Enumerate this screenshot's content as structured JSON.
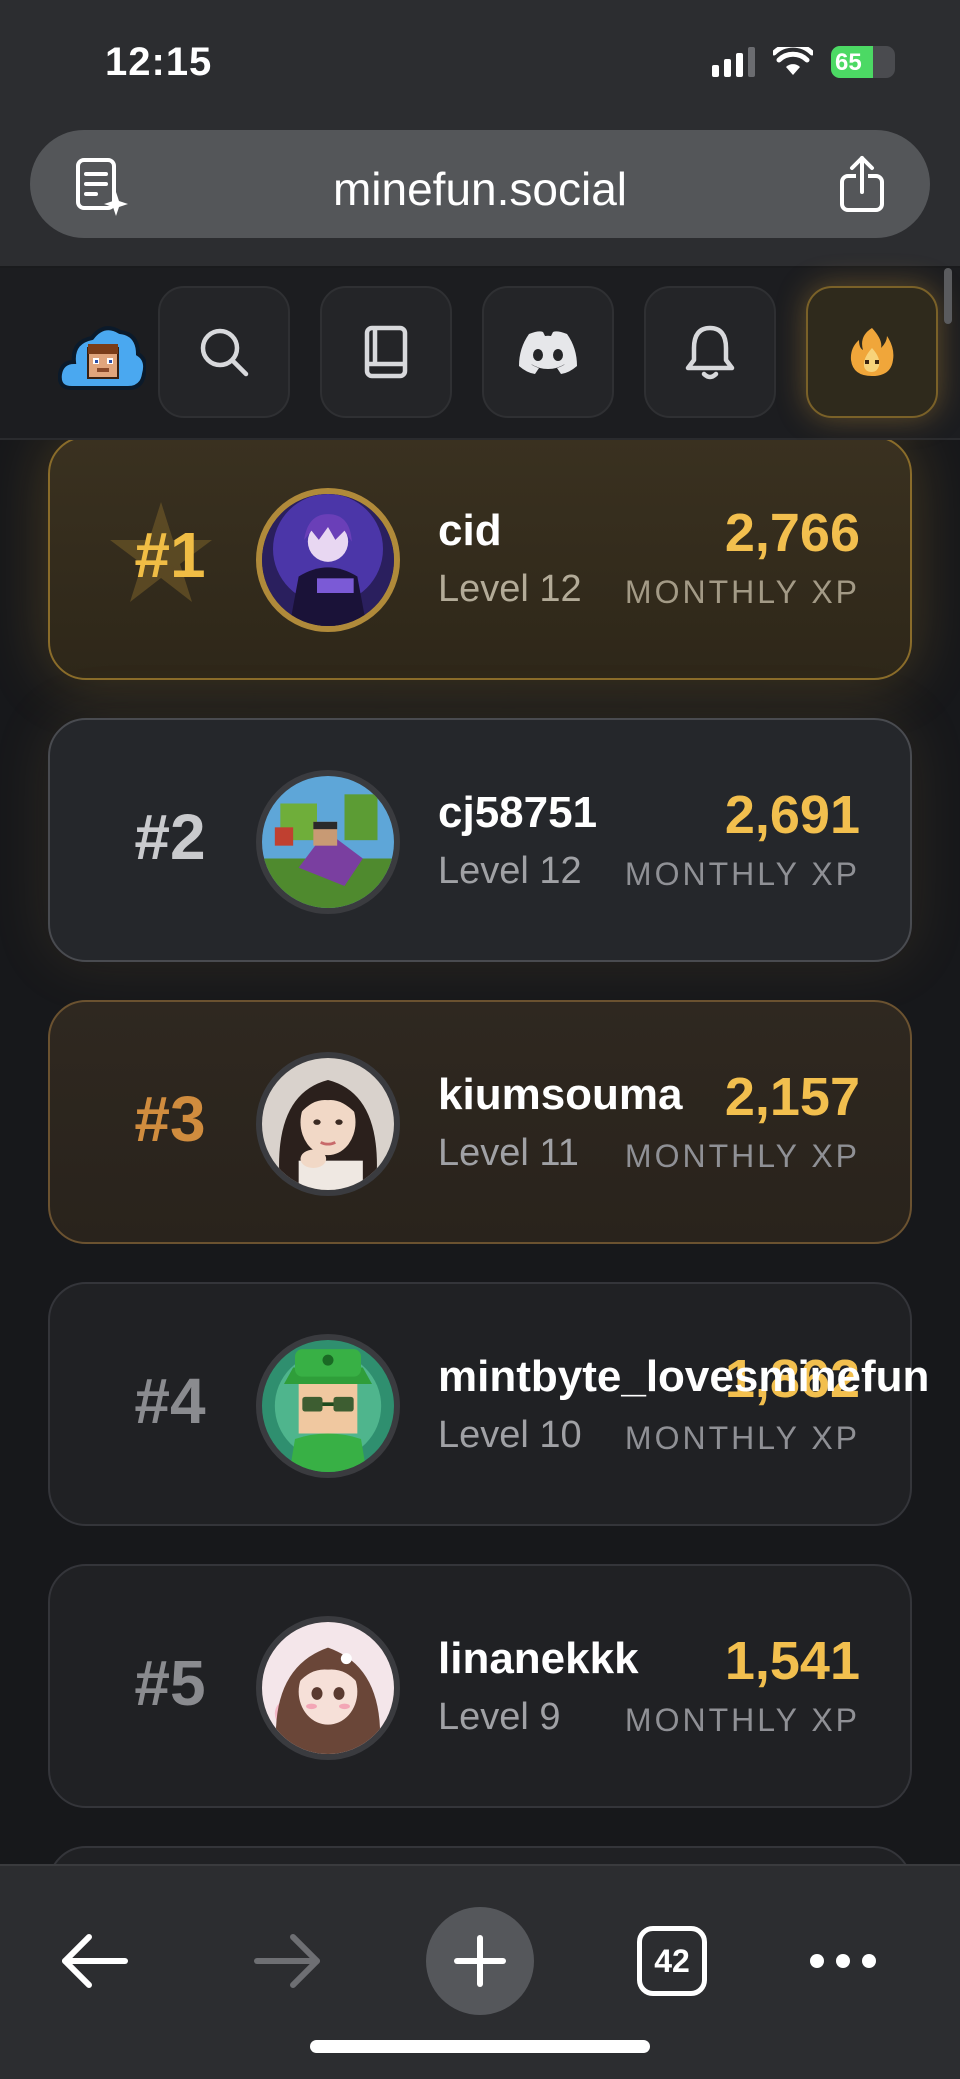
{
  "status": {
    "time": "12:15",
    "battery": "65"
  },
  "browser": {
    "url": "minefun.social",
    "tabs_count": "42"
  },
  "leaderboard": [
    {
      "rank": "#1",
      "name": "cid",
      "level": "Level 12",
      "xp": "2,766",
      "xp_label": "MONTHLY XP",
      "rank_color": "#f0bd45"
    },
    {
      "rank": "#2",
      "name": "cj58751",
      "level": "Level 12",
      "xp": "2,691",
      "xp_label": "MONTHLY XP",
      "rank_color": "#c9cacd"
    },
    {
      "rank": "#3",
      "name": "kiumsouma",
      "level": "Level 11",
      "xp": "2,157",
      "xp_label": "MONTHLY XP",
      "rank_color": "#d08c3e"
    },
    {
      "rank": "#4",
      "name": "mintbyte_lovesminefun",
      "level": "Level 10",
      "xp": "1,862",
      "xp_label": "MONTHLY XP",
      "rank_color": "#8a8b8f"
    },
    {
      "rank": "#5",
      "name": "linanekkk",
      "level": "Level 9",
      "xp": "1,541",
      "xp_label": "MONTHLY XP",
      "rank_color": "#8a8b8f"
    }
  ],
  "icons": {
    "nav": [
      "search-icon",
      "book-icon",
      "discord-icon",
      "bell-icon",
      "fire-icon"
    ],
    "toolbar": [
      "back-arrow-icon",
      "forward-arrow-icon",
      "plus-icon",
      "tabs-icon",
      "more-icon"
    ]
  }
}
